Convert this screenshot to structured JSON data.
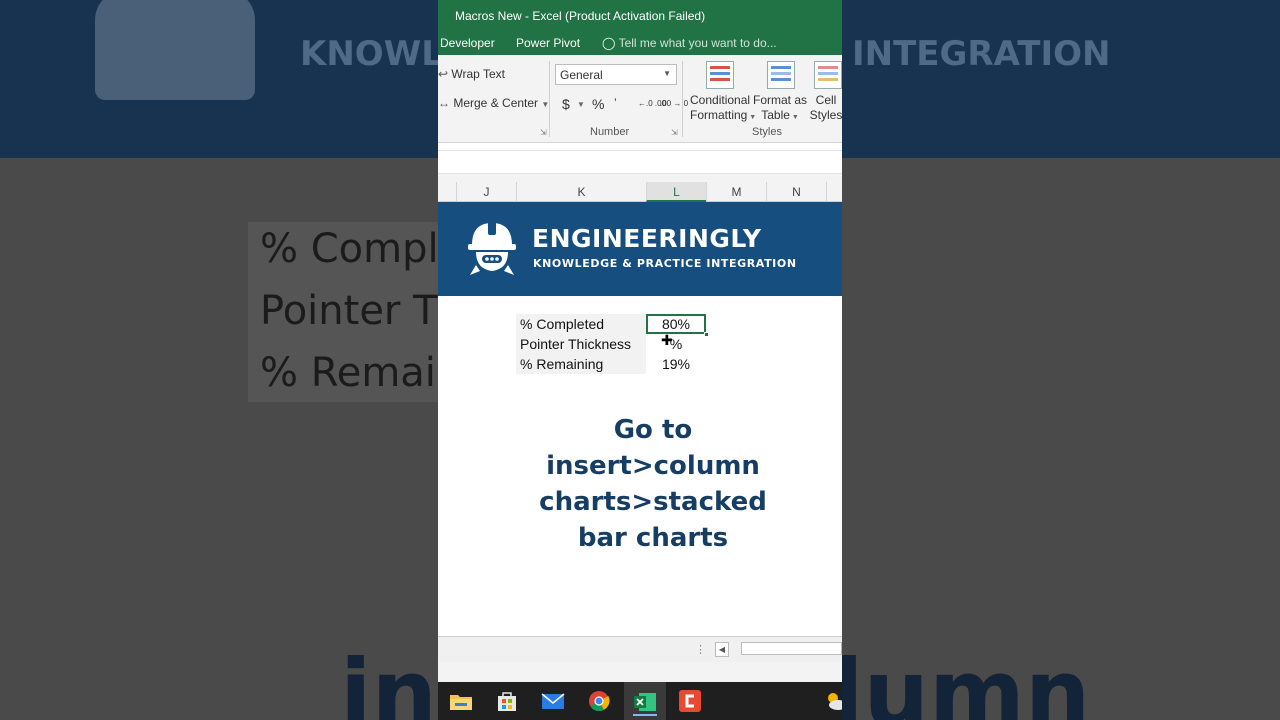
{
  "window": {
    "title": "Macros New - Excel (Product Activation Failed)"
  },
  "ribbon_tabs": {
    "developer": "Developer",
    "power_pivot": "Power Pivot",
    "tell_me": "Tell me what you want to do..."
  },
  "alignment": {
    "wrap_text": "Wrap Text",
    "merge_center": "Merge & Center"
  },
  "number": {
    "format_value": "General",
    "currency": "$",
    "percent": "%",
    "comma": "’",
    "inc_decimal": "←.0 .00",
    "dec_decimal": ".00 →.0",
    "group_label": "Number"
  },
  "styles": {
    "conditional_line1": "Conditional",
    "conditional_line2": "Formatting",
    "format_table_line1": "Format as",
    "format_table_line2": "Table",
    "cell_styles_line1": "Cell",
    "cell_styles_line2": "Styles",
    "group_label": "Styles"
  },
  "columns": [
    "J",
    "K",
    "L",
    "M",
    "N"
  ],
  "selected_column": "L",
  "banner": {
    "brand": "ENGINEERINGLY",
    "tagline": "KNOWLEDGE & PRACTICE INTEGRATION"
  },
  "cells": [
    {
      "label": "% Completed",
      "value": "80%"
    },
    {
      "label": "Pointer Thickness",
      "value": "%"
    },
    {
      "label": "% Remaining",
      "value": "19%"
    }
  ],
  "caption": {
    "line1": "Go to",
    "line2": "insert>column",
    "line3": "charts>stacked",
    "line4": "bar charts"
  },
  "background": {
    "left_row1": "% Compl",
    "left_row2": "Pointer T",
    "left_row3": "% Remai",
    "band_left": "KNOWL",
    "band_right": "INTEGRATION",
    "bottom_left": "ins",
    "bottom_right": "lumn"
  },
  "taskbar": {
    "icons": [
      "file-explorer",
      "microsoft-store",
      "mail",
      "chrome",
      "excel",
      "recorder",
      "weather"
    ]
  },
  "colors": {
    "excel_green": "#217346",
    "banner_blue": "#154e7f",
    "caption_blue": "#163d63"
  }
}
